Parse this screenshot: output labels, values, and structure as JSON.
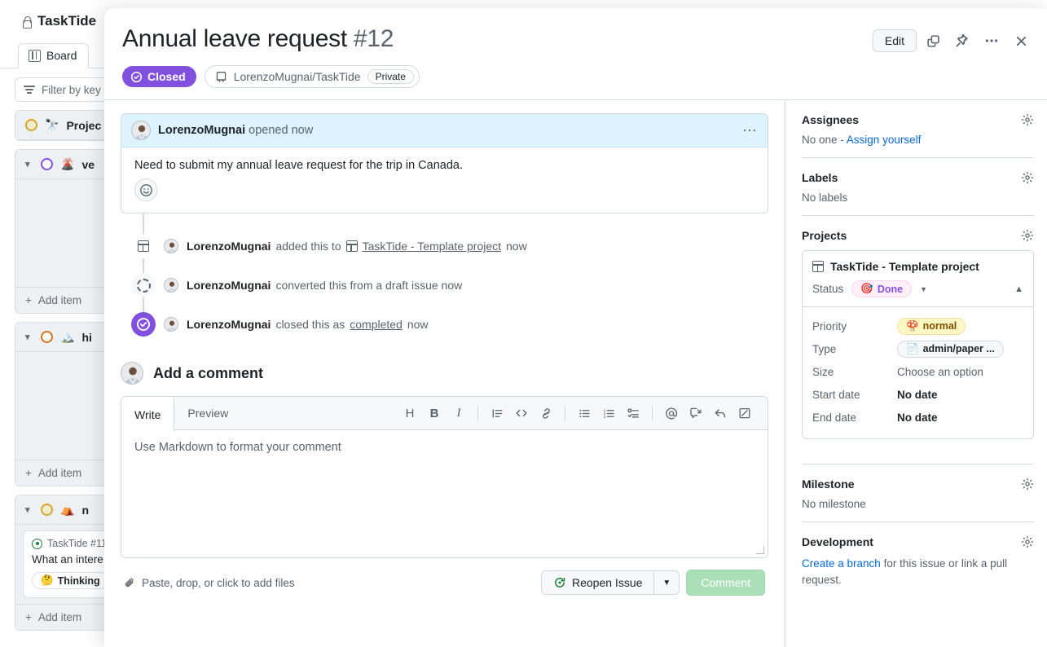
{
  "background": {
    "repo_title": "TaskTide",
    "tab_board": "Board",
    "filter_placeholder": "Filter by key",
    "groups": [
      {
        "title": "Projec",
        "emoji": "🔭",
        "ring": "yellow",
        "add_item": "Add item"
      },
      {
        "title": "ve",
        "emoji": "🌋",
        "ring": "purple",
        "add_item": "Add item"
      },
      {
        "title": "hi",
        "emoji": "🏔️",
        "ring": "orange",
        "add_item": "Add item"
      },
      {
        "title": "n",
        "emoji": "⛺",
        "ring": "yellow",
        "add_item": "Add item"
      }
    ],
    "card": {
      "meta": "TaskTide #11",
      "title": "What an intere",
      "chip_label": "Thinking",
      "chip_emoji": "🤔"
    }
  },
  "modal": {
    "title": "Annual leave request",
    "number": "#12",
    "state_badge": "Closed",
    "repo": "LorenzoMugnai/TaskTide",
    "visibility": "Private",
    "actions": {
      "edit_label": "Edit",
      "copy_icon": "copy-icon",
      "pin_icon": "pin-icon",
      "more_icon": "kebab-icon",
      "close_icon": "close-icon"
    }
  },
  "comment": {
    "author": "LorenzoMugnai",
    "action": "opened now",
    "body": "Need to submit my annual leave request for the trip in Canada.",
    "reaction_icon": "smiley-icon",
    "menu_icon": "kebab-icon"
  },
  "timeline": [
    {
      "icon": "project-table-icon",
      "author": "LorenzoMugnai",
      "text_before": "added this to",
      "link": "TaskTide - Template project",
      "link_icon": "project-table-icon",
      "text_after": "now"
    },
    {
      "icon": "dashed-circle-icon",
      "author": "LorenzoMugnai",
      "text_before": "converted this from a draft issue now",
      "link": "",
      "text_after": ""
    },
    {
      "icon": "closed-check-icon",
      "author": "LorenzoMugnai",
      "text_before": "closed this as",
      "link": "completed",
      "text_after": "now"
    }
  ],
  "add_comment": {
    "heading": "Add a comment",
    "tab_write": "Write",
    "tab_preview": "Preview",
    "placeholder": "Use Markdown to format your comment",
    "toolbar": [
      {
        "name": "heading-icon",
        "glyph": "H"
      },
      {
        "name": "bold-icon",
        "glyph": "B"
      },
      {
        "name": "italic-icon",
        "glyph": "I"
      },
      {
        "name": "quote-icon",
        "glyph": ""
      },
      {
        "name": "code-icon",
        "glyph": ""
      },
      {
        "name": "link-icon",
        "glyph": ""
      },
      {
        "name": "bulleted-list-icon",
        "glyph": ""
      },
      {
        "name": "numbered-list-icon",
        "glyph": ""
      },
      {
        "name": "task-list-icon",
        "glyph": ""
      },
      {
        "name": "mention-icon",
        "glyph": "@"
      },
      {
        "name": "saved-reply-icon",
        "glyph": ""
      },
      {
        "name": "reply-icon",
        "glyph": ""
      },
      {
        "name": "markdown-icon",
        "glyph": ""
      }
    ],
    "attach_text": "Paste, drop, or click to add files",
    "reopen_label": "Reopen Issue",
    "comment_label": "Comment"
  },
  "sidebar": {
    "assignees": {
      "title": "Assignees",
      "value_prefix": "No one - ",
      "link": "Assign yourself"
    },
    "labels": {
      "title": "Labels",
      "value": "No labels"
    },
    "projects": {
      "title": "Projects",
      "project_name": "TaskTide - Template project",
      "status_label": "Status",
      "status_value": "Done",
      "status_emoji": "🎯",
      "fields": [
        {
          "key": "Priority",
          "value": "normal",
          "emoji": "🍄",
          "style": "pill-normal"
        },
        {
          "key": "Type",
          "value": "admin/paper ...",
          "emoji": "📄",
          "style": "pill-type"
        },
        {
          "key": "Size",
          "value": "Choose an option",
          "style": "muted"
        },
        {
          "key": "Start date",
          "value": "No date",
          "style": "plain"
        },
        {
          "key": "End date",
          "value": "No date",
          "style": "plain"
        }
      ]
    },
    "milestone": {
      "title": "Milestone",
      "value": "No milestone"
    },
    "development": {
      "title": "Development",
      "link": "Create a branch",
      "text": " for this issue or link a pull request."
    }
  },
  "colors": {
    "closed_purple": "#8250df",
    "link_blue": "#0969da",
    "comment_header_blue": "#ddf4ff",
    "comment_button_green": "#aadfb8",
    "done_pink_bg": "#ffeff7",
    "normal_yellow_bg": "#fff8c5"
  }
}
